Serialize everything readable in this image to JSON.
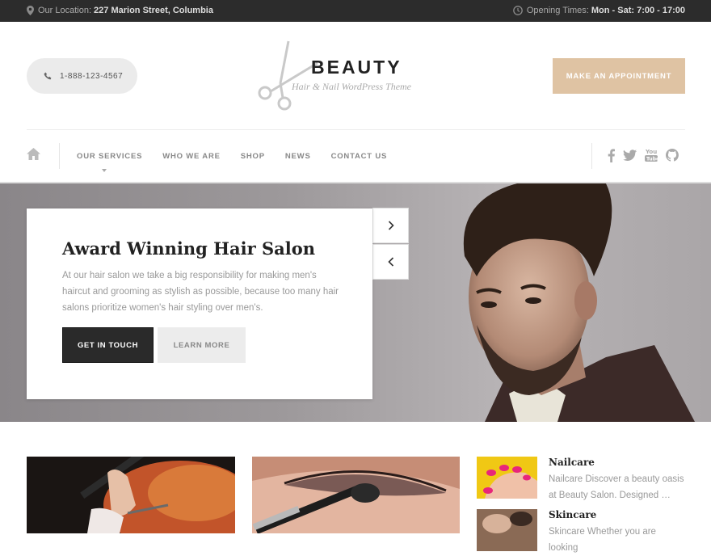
{
  "topbar": {
    "location_label": "Our Location:",
    "location_value": "227 Marion Street, Columbia",
    "hours_label": "Opening Times:",
    "hours_value": "Mon - Sat: 7:00 - 17:00"
  },
  "header": {
    "phone": "1-888-123-4567",
    "logo_title": "BEAUTY",
    "logo_subtitle": "Hair & Nail WordPress Theme",
    "appointment_label": "MAKE AN APPOINTMENT"
  },
  "nav": {
    "items": [
      "OUR SERVICES",
      "WHO WE ARE",
      "SHOP",
      "NEWS",
      "CONTACT US"
    ]
  },
  "hero": {
    "title": "Award Winning Hair Salon",
    "text": "At our hair salon we take a big responsibility for making men's haircut and grooming as stylish as possible, because too many hair salons prioritize women's hair styling over men's.",
    "primary_button": "GET IN TOUCH",
    "secondary_button": "LEARN MORE"
  },
  "sidebar_posts": [
    {
      "title": "Nailcare",
      "excerpt": "Nailcare Discover a beauty oasis at Beauty Salon. Designed …"
    },
    {
      "title": "Skincare",
      "excerpt": "Skincare Whether you are looking"
    }
  ],
  "colors": {
    "accent": "#dfc3a3",
    "topbar_bg": "#2c2c2c",
    "dark_button": "#2a2a2a"
  },
  "icons": {
    "location": "map-pin-icon",
    "clock": "clock-icon",
    "phone": "phone-icon",
    "home": "home-icon",
    "facebook": "facebook-icon",
    "twitter": "twitter-icon",
    "youtube": "youtube-icon",
    "github": "github-icon"
  }
}
